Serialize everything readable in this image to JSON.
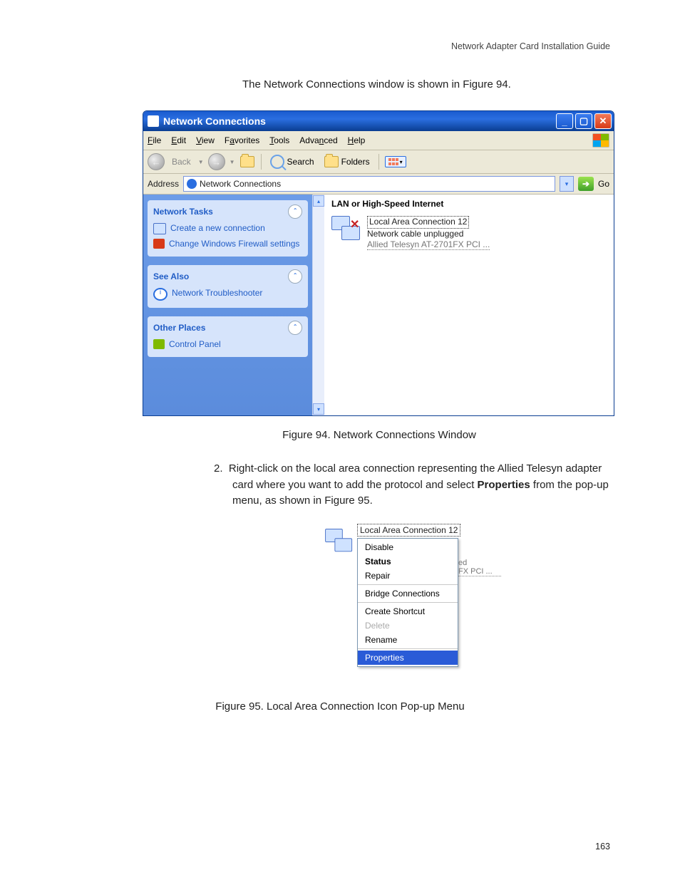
{
  "header": {
    "doc_title": "Network Adapter Card Installation Guide"
  },
  "intro": "The Network Connections window is shown in Figure 94.",
  "window": {
    "title": "Network Connections",
    "menu": {
      "file": "File",
      "edit": "Edit",
      "view": "View",
      "favorites": "Favorites",
      "tools": "Tools",
      "advanced": "Advanced",
      "help": "Help"
    },
    "toolbar": {
      "back": "Back",
      "search": "Search",
      "folders": "Folders"
    },
    "address": {
      "label": "Address",
      "value": "Network Connections",
      "go": "Go"
    },
    "side": {
      "tasks_hd": "Network Tasks",
      "task1": "Create a new connection",
      "task2": "Change Windows Firewall settings",
      "see_hd": "See Also",
      "see1": "Network Troubleshooter",
      "other_hd": "Other Places",
      "other1": "Control Panel"
    },
    "content": {
      "section": "LAN or High-Speed Internet",
      "conn_name": "Local Area Connection 12",
      "conn_status": "Network cable unplugged",
      "conn_adapter": "Allied Telesyn AT-2701FX PCI ..."
    }
  },
  "caption94": "Figure 94. Network Connections Window",
  "step2": {
    "num": "2.",
    "text_a": "Right-click on the local area connection representing the Allied Telesyn adapter card where you want to add the protocol and select ",
    "bold": "Properties",
    "text_b": " from the pop-up menu, as shown in Figure 95."
  },
  "popup": {
    "label": "Local Area Connection 12",
    "behind_a": "ed",
    "behind_b": "FX PCI ...",
    "items": {
      "disable": "Disable",
      "status": "Status",
      "repair": "Repair",
      "bridge": "Bridge Connections",
      "shortcut": "Create Shortcut",
      "delete": "Delete",
      "rename": "Rename",
      "properties": "Properties"
    }
  },
  "caption95": "Figure 95. Local Area Connection Icon Pop-up Menu",
  "page_number": "163"
}
